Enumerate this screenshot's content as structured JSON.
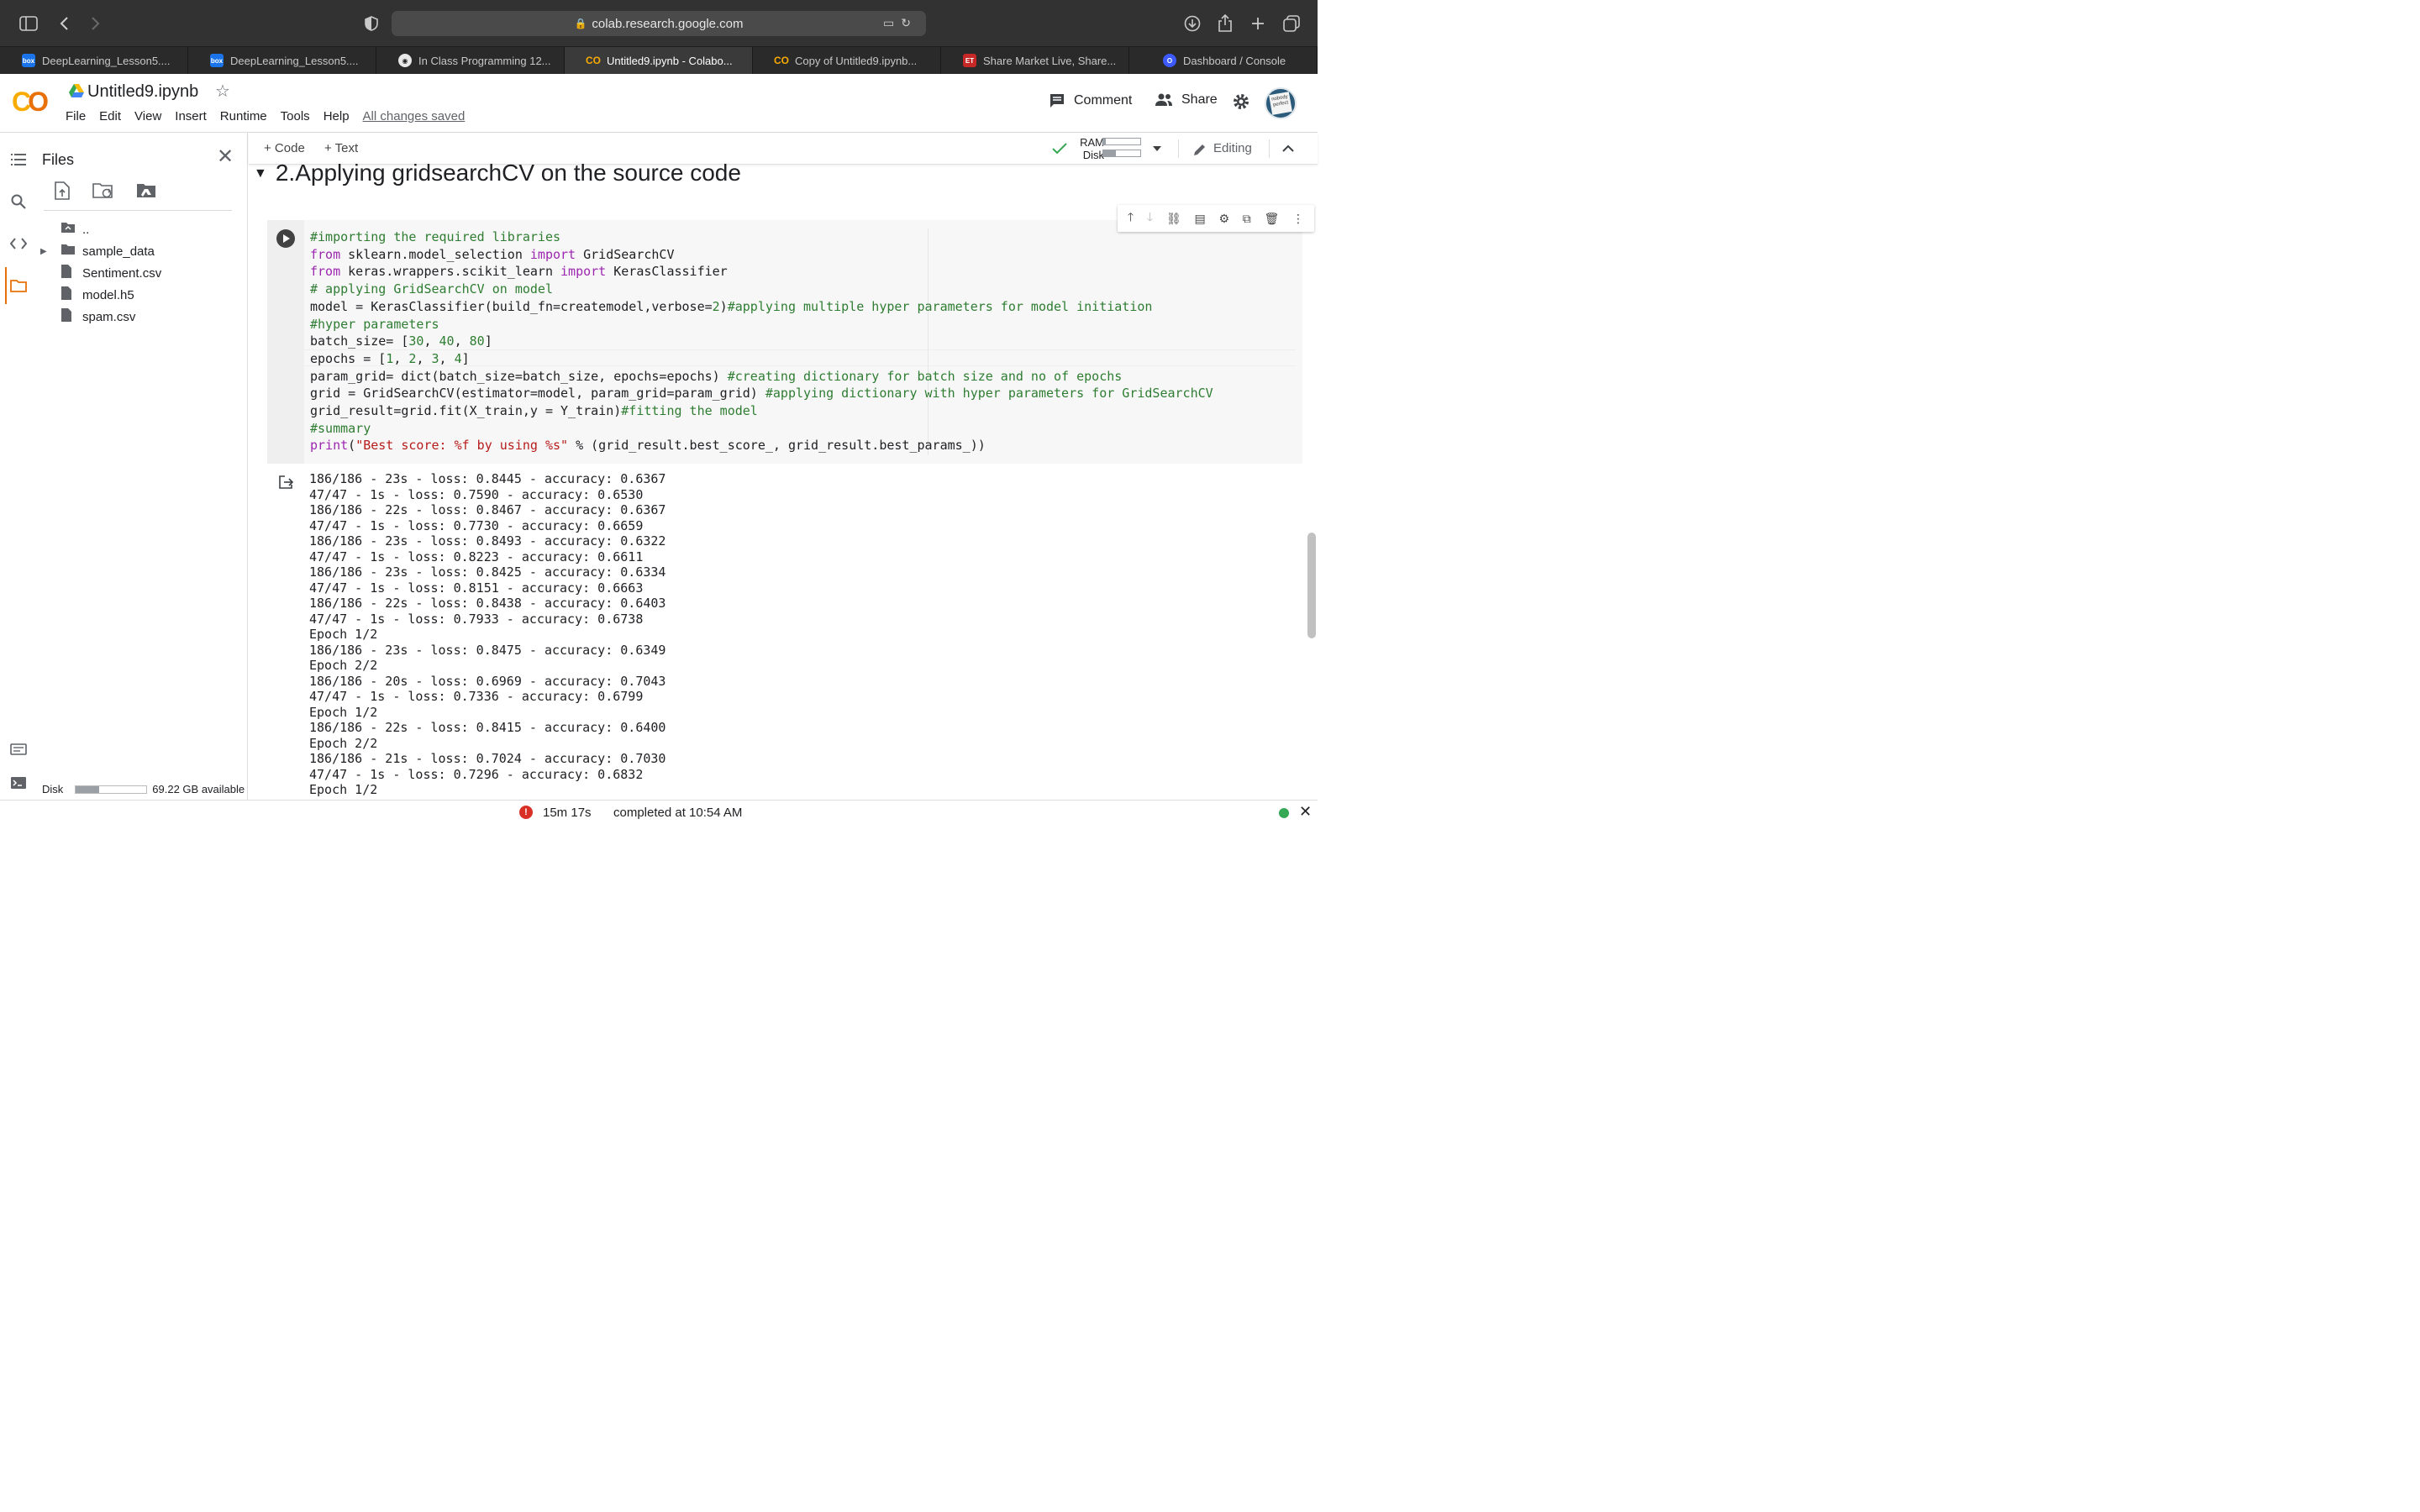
{
  "browser": {
    "url": "colab.research.google.com",
    "tabs": [
      {
        "label": "DeepLearning_Lesson5....",
        "fav": "box",
        "favcolor": "#1a73e8"
      },
      {
        "label": "DeepLearning_Lesson5....",
        "fav": "box",
        "favcolor": "#1a73e8"
      },
      {
        "label": "In Class Programming 12...",
        "fav": "gh",
        "favcolor": "#e8e8e8"
      },
      {
        "label": "Untitled9.ipynb - Colabo...",
        "fav": "co",
        "favcolor": "#f9ab00"
      },
      {
        "label": "Copy of Untitled9.ipynb...",
        "fav": "co",
        "favcolor": "#f9ab00"
      },
      {
        "label": "Share Market Live, Share...",
        "fav": "ET",
        "favcolor": "#c62828"
      },
      {
        "label": "Dashboard / Console",
        "fav": "o",
        "favcolor": "#3d5afe"
      }
    ]
  },
  "header": {
    "notebook_title": "Untitled9.ipynb",
    "menus": [
      "File",
      "Edit",
      "View",
      "Insert",
      "Runtime",
      "Tools",
      "Help"
    ],
    "saved_status": "All changes saved",
    "comment_label": "Comment",
    "share_label": "Share"
  },
  "files_panel": {
    "title": "Files",
    "items": [
      {
        "name": "..",
        "kind": "up"
      },
      {
        "name": "sample_data",
        "kind": "folder"
      },
      {
        "name": "Sentiment.csv",
        "kind": "file"
      },
      {
        "name": "model.h5",
        "kind": "file"
      },
      {
        "name": "spam.csv",
        "kind": "file"
      }
    ],
    "disk_label": "Disk",
    "disk_available": "69.22 GB available",
    "disk_fraction": 0.33
  },
  "toolbar": {
    "add_code": "+ Code",
    "add_text": "+ Text",
    "ram_label": "RAM",
    "disk_label": "Disk",
    "ram_fraction": 0.06,
    "disk_fraction": 0.35,
    "editing_label": "Editing"
  },
  "notebook": {
    "section_heading": "2.Applying gridsearchCV on the source code",
    "code_lines": [
      [
        [
          "cm",
          "#importing the required libraries"
        ]
      ],
      [
        [
          "kw",
          "from"
        ],
        [
          "",
          " sklearn.model_selection "
        ],
        [
          "kw",
          "import"
        ],
        [
          "",
          " GridSearchCV"
        ]
      ],
      [
        [
          "kw",
          "from"
        ],
        [
          "",
          " keras.wrappers.scikit_learn "
        ],
        [
          "kw",
          "import"
        ],
        [
          "",
          " KerasClassifier"
        ]
      ],
      [
        [
          "cm",
          "# applying GridSearchCV on model"
        ]
      ],
      [
        [
          "",
          "model = KerasClassifier(build_fn=createmodel,verbose="
        ],
        [
          "nm",
          "2"
        ],
        [
          "",
          ")"
        ],
        [
          "cm",
          "#applying multiple hyper parameters for model initiation"
        ]
      ],
      [
        [
          "cm",
          "#hyper parameters"
        ]
      ],
      [
        [
          "",
          "batch_size= ["
        ],
        [
          "nm",
          "30"
        ],
        [
          "",
          ", "
        ],
        [
          "nm",
          "40"
        ],
        [
          "",
          ", "
        ],
        [
          "nm",
          "80"
        ],
        [
          "",
          "]"
        ]
      ],
      [
        [
          "",
          "epochs = ["
        ],
        [
          "nm",
          "1"
        ],
        [
          "",
          ", "
        ],
        [
          "nm",
          "2"
        ],
        [
          "",
          ", "
        ],
        [
          "nm",
          "3"
        ],
        [
          "",
          ", "
        ],
        [
          "nm",
          "4"
        ],
        [
          "",
          "]"
        ]
      ],
      [
        [
          "",
          "param_grid= dict(batch_size=batch_size, epochs=epochs) "
        ],
        [
          "cm",
          "#creating dictionary for batch size and no of epochs"
        ]
      ],
      [
        [
          "",
          "grid = GridSearchCV(estimator=model, param_grid=param_grid) "
        ],
        [
          "cm",
          "#applying dictionary with hyper parameters for GridSearchCV"
        ]
      ],
      [
        [
          "",
          "grid_result=grid.fit(X_train,y = Y_train)"
        ],
        [
          "cm",
          "#fitting the model"
        ]
      ],
      [
        [
          "cm",
          "#summary"
        ]
      ],
      [
        [
          "kw",
          "print"
        ],
        [
          "",
          "("
        ],
        [
          "st",
          "\"Best score: %f by using %s\""
        ],
        [
          "",
          " % (grid_result.best_score_, grid_result.best_params_))"
        ]
      ]
    ],
    "output_lines": [
      "186/186 - 23s - loss: 0.8445 - accuracy: 0.6367",
      "47/47 - 1s - loss: 0.7590 - accuracy: 0.6530",
      "186/186 - 22s - loss: 0.8467 - accuracy: 0.6367",
      "47/47 - 1s - loss: 0.7730 - accuracy: 0.6659",
      "186/186 - 23s - loss: 0.8493 - accuracy: 0.6322",
      "47/47 - 1s - loss: 0.8223 - accuracy: 0.6611",
      "186/186 - 23s - loss: 0.8425 - accuracy: 0.6334",
      "47/47 - 1s - loss: 0.8151 - accuracy: 0.6663",
      "186/186 - 22s - loss: 0.8438 - accuracy: 0.6403",
      "47/47 - 1s - loss: 0.7933 - accuracy: 0.6738",
      "Epoch 1/2",
      "186/186 - 23s - loss: 0.8475 - accuracy: 0.6349",
      "Epoch 2/2",
      "186/186 - 20s - loss: 0.6969 - accuracy: 0.7043",
      "47/47 - 1s - loss: 0.7336 - accuracy: 0.6799",
      "Epoch 1/2",
      "186/186 - 22s - loss: 0.8415 - accuracy: 0.6400",
      "Epoch 2/2",
      "186/186 - 21s - loss: 0.7024 - accuracy: 0.7030",
      "47/47 - 1s - loss: 0.7296 - accuracy: 0.6832",
      "Epoch 1/2"
    ]
  },
  "statusbar": {
    "elapsed": "15m 17s",
    "completed": "completed at 10:54 AM"
  },
  "colors": {
    "accent_orange": "#e8710a",
    "accent_yellow": "#f9ab00",
    "error_red": "#d93025",
    "ok_green": "#34a853"
  }
}
